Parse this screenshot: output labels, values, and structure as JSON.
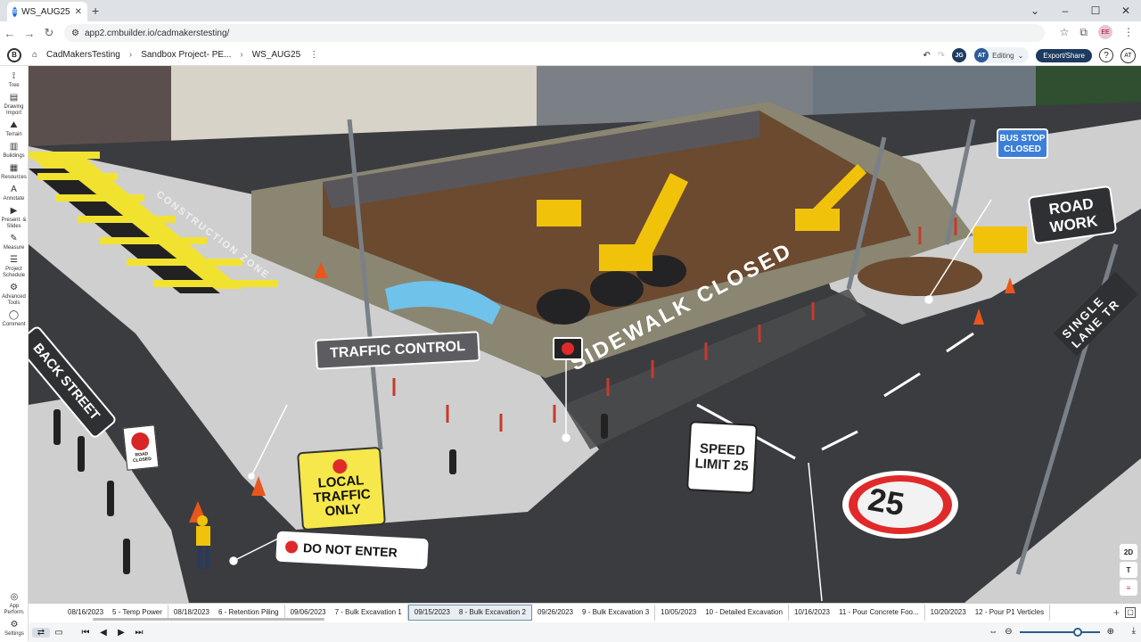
{
  "browser": {
    "tab_title": "WS_AUG25",
    "url": "app2.cmbuilder.io/cadmakerstesting/",
    "profile": "EE"
  },
  "header": {
    "breadcrumbs": [
      "CadMakersTesting",
      "Sandbox Project- PE...",
      "WS_AUG25"
    ],
    "user1": "JG",
    "user2": "AT",
    "editing_label": "Editing",
    "export_label": "Export/Share",
    "account": "AT"
  },
  "left_tools": [
    {
      "label": "Tree",
      "icon": "tree-icon"
    },
    {
      "label": "Drawing Import",
      "icon": "drawing-import-icon"
    },
    {
      "label": "Terrain",
      "icon": "terrain-icon"
    },
    {
      "label": "Buildings",
      "icon": "buildings-icon"
    },
    {
      "label": "Resources",
      "icon": "resources-icon"
    },
    {
      "label": "Annotate",
      "icon": "annotate-icon"
    },
    {
      "label": "Present. & Slides",
      "icon": "present-icon"
    },
    {
      "label": "Measure",
      "icon": "measure-icon"
    },
    {
      "label": "Project Schedule",
      "icon": "schedule-icon"
    },
    {
      "label": "Advanced Tools",
      "icon": "advanced-tools-icon"
    },
    {
      "label": "Comment",
      "icon": "comment-icon"
    }
  ],
  "left_bottom": [
    {
      "label": "App Perform.",
      "icon": "app-performance-icon"
    },
    {
      "label": "Settings",
      "icon": "settings-icon"
    }
  ],
  "scene_labels": {
    "traffic_control": "TRAFFIC CONTROL",
    "local_traffic": "LOCAL TRAFFIC ONLY",
    "do_not_enter": "DO NOT ENTER",
    "speed_limit": "SPEED LIMIT 25",
    "sidewalk_closed": "SIDEWALK CLOSED",
    "road_work": "ROAD WORK",
    "bus_stop": "BUS STOP CLOSED",
    "back_street": "BACK STREET",
    "construction_zone": "CONSTRUCTION ZONE",
    "single_lane": "SINGLE LANE TR",
    "speed_25": "25",
    "road_closed": "ROAD CLOSED"
  },
  "viewport_controls": [
    "2D",
    "T",
    "≡"
  ],
  "timeline": [
    {
      "date": "08/16/2023",
      "label": "5 - Temp Power"
    },
    {
      "date": "08/18/2023",
      "label": "6 - Retention Piling"
    },
    {
      "date": "09/06/2023",
      "label": "7 - Bulk Excavation 1"
    },
    {
      "date": "09/15/2023",
      "label": "8 - Bulk Excavation 2",
      "active": true
    },
    {
      "date": "09/26/2023",
      "label": "9 - Bulk Excavation 3"
    },
    {
      "date": "10/05/2023",
      "label": "10 - Detailed Excavation"
    },
    {
      "date": "10/16/2023",
      "label": "11 - Pour Concrete Foo..."
    },
    {
      "date": "10/20/2023",
      "label": "12 - Pour P1 Verticles"
    }
  ],
  "colors": {
    "header_dark": "#1e3a5f",
    "road": "#3b3c40",
    "sidewalk": "#cfcfcf",
    "dirt": "#6b4a30",
    "sign_yellow": "#f6e84a",
    "sign_blue": "#3c7fd8",
    "cone": "#e8561c"
  }
}
